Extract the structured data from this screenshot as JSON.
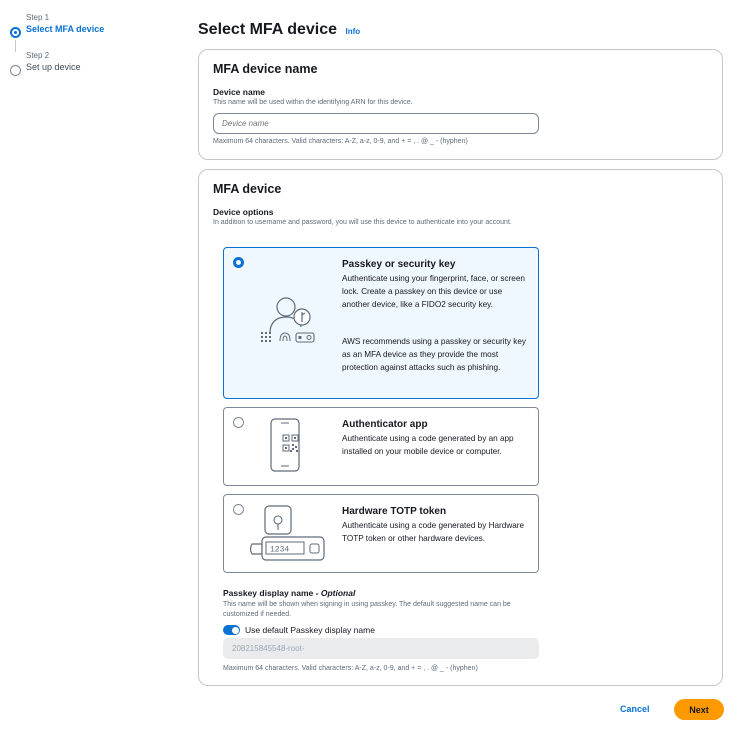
{
  "steps": [
    {
      "number": "Step 1",
      "title": "Select MFA device"
    },
    {
      "number": "Step 2",
      "title": "Set up device"
    }
  ],
  "page": {
    "title": "Select MFA device",
    "info_link": "Info"
  },
  "device_name_card": {
    "heading": "MFA device name",
    "label": "Device name",
    "description": "This name will be used within the identifying ARN for this device.",
    "placeholder": "Device name",
    "constraint": "Maximum 64 characters. Valid characters: A-Z, a-z, 0-9, and + = , . @ _ - (hyphen)"
  },
  "device_card": {
    "heading": "MFA device",
    "label": "Device options",
    "description": "In addition to username and password, you will use this device to authenticate into your account.",
    "options": [
      {
        "title": "Passkey or security key",
        "text1": "Authenticate using your fingerprint, face, or screen lock. Create a passkey on this device or use another device, like a FIDO2 security key.",
        "text2": "AWS recommends using a passkey or security key as an MFA device as they provide the most protection against attacks such as phishing.",
        "selected": true,
        "icon": "passkey-illustration"
      },
      {
        "title": "Authenticator app",
        "text1": "Authenticate using a code generated by an app installed on your mobile device or computer.",
        "selected": false,
        "icon": "authenticator-app-illustration"
      },
      {
        "title": "Hardware TOTP token",
        "text1": "Authenticate using a code generated by Hardware TOTP token or other hardware devices.",
        "selected": false,
        "icon": "hardware-token-illustration",
        "token_digits": "1234"
      }
    ],
    "passkey_display": {
      "label": "Passkey display name",
      "optional": "- Optional",
      "description": "This name will be shown when signing in using passkey. The default suggested name can be customized if needed.",
      "toggle_label": "Use default Passkey display name",
      "toggle_on": true,
      "value": "208215845548-root-",
      "constraint": "Maximum 64 characters. Valid characters: A-Z, a-z, 0-9, and + = , . @ _ - (hyphen)"
    }
  },
  "footer": {
    "cancel": "Cancel",
    "next": "Next"
  },
  "colors": {
    "accent": "#0972d3",
    "primary_button": "#ff9900",
    "border": "#c6c6cd"
  }
}
